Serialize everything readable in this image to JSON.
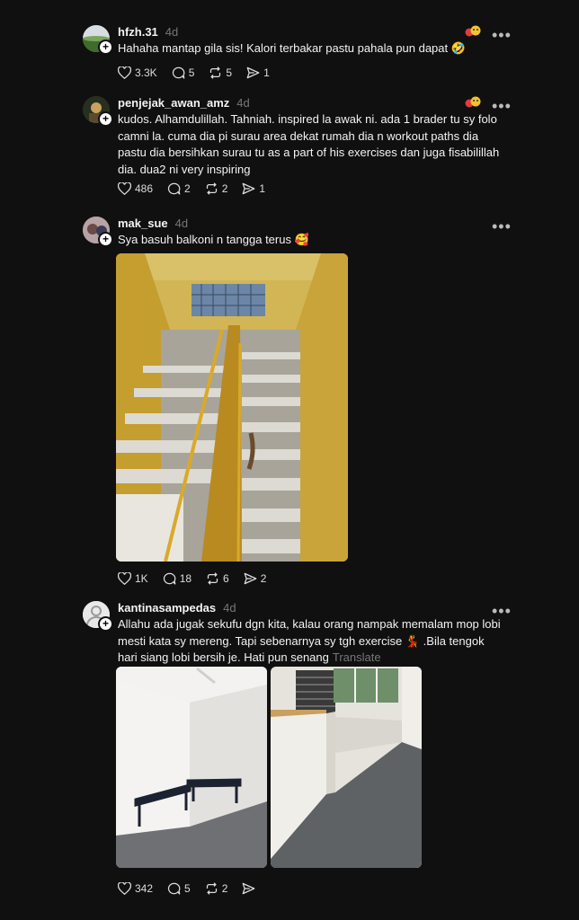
{
  "posts": [
    {
      "username": "hfzh.31",
      "time": "4d",
      "text": "Hahaha mantap gila sis! Kalori terbakar pastu pahala pun dapat 🤣",
      "likes": "3.3K",
      "comments": "5",
      "reposts": "5",
      "shares": "1"
    },
    {
      "username": "penjejak_awan_amz",
      "time": "4d",
      "text": "kudos. Alhamdulillah. Tahniah. inspired la awak ni. ada 1 brader tu sy folo camni la. cuma dia pi surau area dekat rumah dia n workout paths dia pastu dia bersihkan surau tu as a part of his exercises dan juga fisabilillah dia. dua2 ni very inspiring",
      "likes": "486",
      "comments": "2",
      "reposts": "2",
      "shares": "1"
    },
    {
      "username": "mak_sue",
      "time": "4d",
      "text": "Sya basuh balkoni n tangga terus 🥰",
      "likes": "1K",
      "comments": "18",
      "reposts": "6",
      "shares": "2"
    },
    {
      "username": "kantinasampedas",
      "time": "4d",
      "text": "Allahu ada jugak sekufu dgn kita, kalau orang nampak memalam mop lobi mesti kata sy mereng. Tapi sebenarnya sy tgh exercise 💃 .Bila tengok hari siang lobi bersih je. Hati pun senang",
      "translate": "Translate",
      "likes": "342",
      "comments": "5",
      "reposts": "2",
      "shares": ""
    }
  ],
  "icons": {
    "like": "heart-icon",
    "comment": "comment-icon",
    "repost": "repost-icon",
    "share": "share-icon",
    "more": "more-icon",
    "reaction": "reaction-emoji-icon"
  },
  "colors": {
    "background": "#101010",
    "text": "#f3f3f3",
    "muted": "#777777"
  }
}
